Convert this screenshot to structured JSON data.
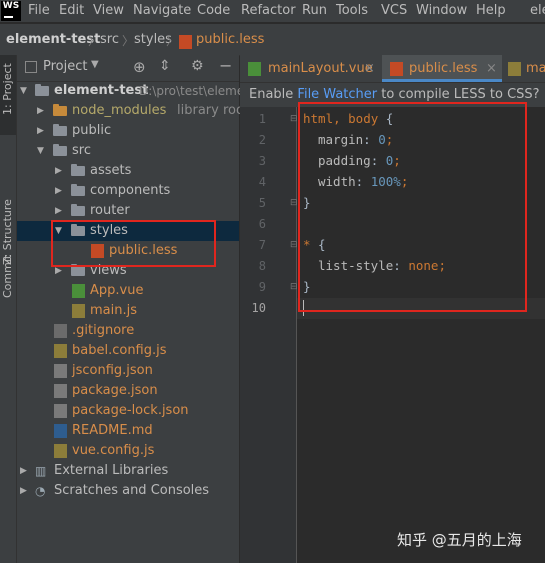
{
  "menubar": {
    "logo": "WS",
    "items": [
      "File",
      "Edit",
      "View",
      "Navigate",
      "Code",
      "Refactor",
      "Run",
      "Tools",
      "VCS",
      "Window",
      "Help",
      "ele"
    ]
  },
  "breadcrumb": [
    "element-test",
    "src",
    "styles",
    "public.less"
  ],
  "side_tabs": [
    "1: Project",
    "Z: Structure",
    "Commit"
  ],
  "project_panel": {
    "title": "Project",
    "root": "element-test",
    "root_path": "D:\\pro\\test\\eleme",
    "items": [
      {
        "label": "node_modules",
        "extra": "library root"
      },
      {
        "label": "public"
      },
      {
        "label": "src"
      },
      {
        "label": "assets"
      },
      {
        "label": "components"
      },
      {
        "label": "router"
      },
      {
        "label": "styles"
      },
      {
        "label": "public.less"
      },
      {
        "label": "views"
      },
      {
        "label": "App.vue"
      },
      {
        "label": "main.js"
      },
      {
        "label": ".gitignore"
      },
      {
        "label": "babel.config.js"
      },
      {
        "label": "jsconfig.json"
      },
      {
        "label": "package.json"
      },
      {
        "label": "package-lock.json"
      },
      {
        "label": "README.md"
      },
      {
        "label": "vue.config.js"
      },
      {
        "label": "External Libraries"
      },
      {
        "label": "Scratches and Consoles"
      }
    ]
  },
  "editor_tabs": [
    {
      "label": "mainLayout.vue",
      "close": "×"
    },
    {
      "label": "public.less",
      "close": "×"
    },
    {
      "label": "main"
    }
  ],
  "banner": {
    "prefix": "Enable ",
    "link": "File Watcher",
    "suffix": " to compile LESS to CSS?"
  },
  "code": {
    "line_numbers": [
      "1",
      "2",
      "3",
      "4",
      "5",
      "6",
      "7",
      "8",
      "9",
      "10"
    ],
    "l1_sel": "html, body",
    "l1_brace": " {",
    "l2_prop": "margin",
    "l2_val": "0",
    "l3_prop": "padding",
    "l3_val": "0",
    "l4_prop": "width",
    "l4_val": "100%",
    "close_brace": "}",
    "l7_sel": "*",
    "l7_brace": " {",
    "l8_prop": "list-style",
    "l8_val": "none",
    "colon": ": ",
    "semi": ";"
  },
  "watermark": "知乎 @五月的上海",
  "colors": {
    "highlight_box": "#e0261e",
    "keyword": "#cc7832",
    "number": "#6897bb",
    "link": "#589df6"
  }
}
